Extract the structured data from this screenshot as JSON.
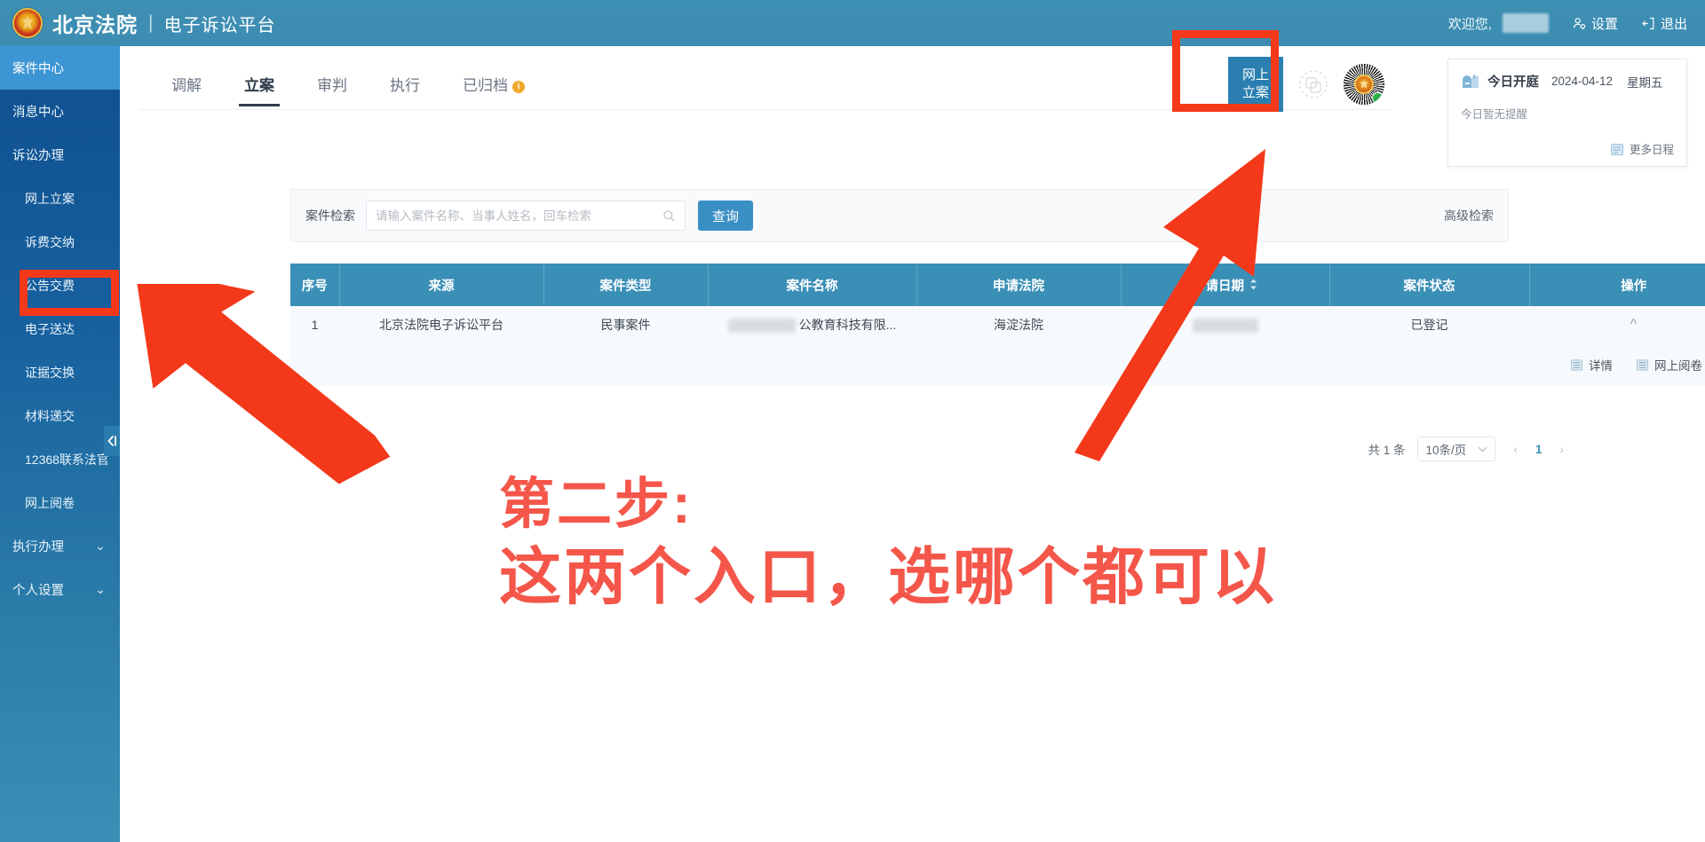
{
  "header": {
    "brand_name": "北京法院",
    "brand_separator": "|",
    "brand_sub": "电子诉讼平台",
    "welcome_label": "欢迎您,",
    "settings_label": "设置",
    "logout_label": "退出",
    "emblem_icon": "court-emblem-icon",
    "settings_icon": "user-gear-icon",
    "logout_icon": "exit-door-icon"
  },
  "sidebar": {
    "items": [
      {
        "label": "案件中心",
        "active": true,
        "sub": false,
        "chevron": ""
      },
      {
        "label": "消息中心",
        "active": false,
        "sub": false,
        "chevron": ""
      },
      {
        "label": "诉讼办理",
        "active": false,
        "sub": false,
        "chevron": ""
      },
      {
        "label": "网上立案",
        "active": false,
        "sub": true,
        "chevron": ""
      },
      {
        "label": "诉费交纳",
        "active": false,
        "sub": true,
        "chevron": ""
      },
      {
        "label": "公告交费",
        "active": false,
        "sub": true,
        "chevron": ""
      },
      {
        "label": "电子送达",
        "active": false,
        "sub": true,
        "chevron": ""
      },
      {
        "label": "证据交换",
        "active": false,
        "sub": true,
        "chevron": ""
      },
      {
        "label": "材料递交",
        "active": false,
        "sub": true,
        "chevron": ""
      },
      {
        "label": "12368联系法官",
        "active": false,
        "sub": true,
        "chevron": ""
      },
      {
        "label": "网上阅卷",
        "active": false,
        "sub": true,
        "chevron": ""
      },
      {
        "label": "执行办理",
        "active": false,
        "sub": false,
        "chevron": "⌄"
      },
      {
        "label": "个人设置",
        "active": false,
        "sub": false,
        "chevron": "⌄"
      }
    ],
    "collapse_icon": "collapse-left-icon"
  },
  "tabs": [
    {
      "label": "调解",
      "active": false,
      "badge": ""
    },
    {
      "label": "立案",
      "active": true,
      "badge": ""
    },
    {
      "label": "审判",
      "active": false,
      "badge": ""
    },
    {
      "label": "执行",
      "active": false,
      "badge": ""
    },
    {
      "label": "已归档",
      "active": false,
      "badge": "i"
    }
  ],
  "toolbar": {
    "online_filing_line1": "网上",
    "online_filing_line2": "立案",
    "scan_icon": "scan-code-icon",
    "qr_badge_icon": "qr-emblem-badge-icon"
  },
  "schedule": {
    "icon": "mailbox-icon",
    "title": "今日开庭",
    "date": "2024-04-12",
    "weekday": "星期五",
    "empty_text": "今日暂无提醒",
    "more_label": "更多日程",
    "more_icon": "calendar-icon"
  },
  "search": {
    "label": "案件检索",
    "placeholder": "请输入案件名称、当事人姓名，回车检索",
    "value": "",
    "search_icon": "search-icon",
    "query_button": "查询",
    "advanced_label": "高级检索"
  },
  "table": {
    "headers": [
      "序号",
      "来源",
      "案件类型",
      "案件名称",
      "申请法院",
      "申请日期",
      "案件状态",
      "操作"
    ],
    "sort_column": "申请日期",
    "sort_icon": "sort-arrows-icon",
    "rows": [
      {
        "index": "1",
        "source": "北京法院电子诉讼平台",
        "case_type": "民事案件",
        "case_name_redacted": true,
        "case_name": "公教育科技有限...",
        "court": "海淀法院",
        "apply_date_redacted": true,
        "apply_date": "",
        "status": "已登记",
        "expand_icon": "chevron-up-icon",
        "actions": [
          {
            "label": "详情",
            "icon": "detail-list-icon"
          },
          {
            "label": "网上阅卷",
            "icon": "file-read-icon"
          }
        ]
      }
    ]
  },
  "pagination": {
    "total_label": "共 1 条",
    "page_size": "10条/页",
    "prev_icon": "chevron-left-icon",
    "next_icon": "chevron-right-icon",
    "current_page": "1"
  },
  "annotation": {
    "line1": "第二步:",
    "line2": "这两个入口，选哪个都可以",
    "color": "#f4564a",
    "box_color": "#f4381a",
    "arrow_color": "#f4381a"
  }
}
